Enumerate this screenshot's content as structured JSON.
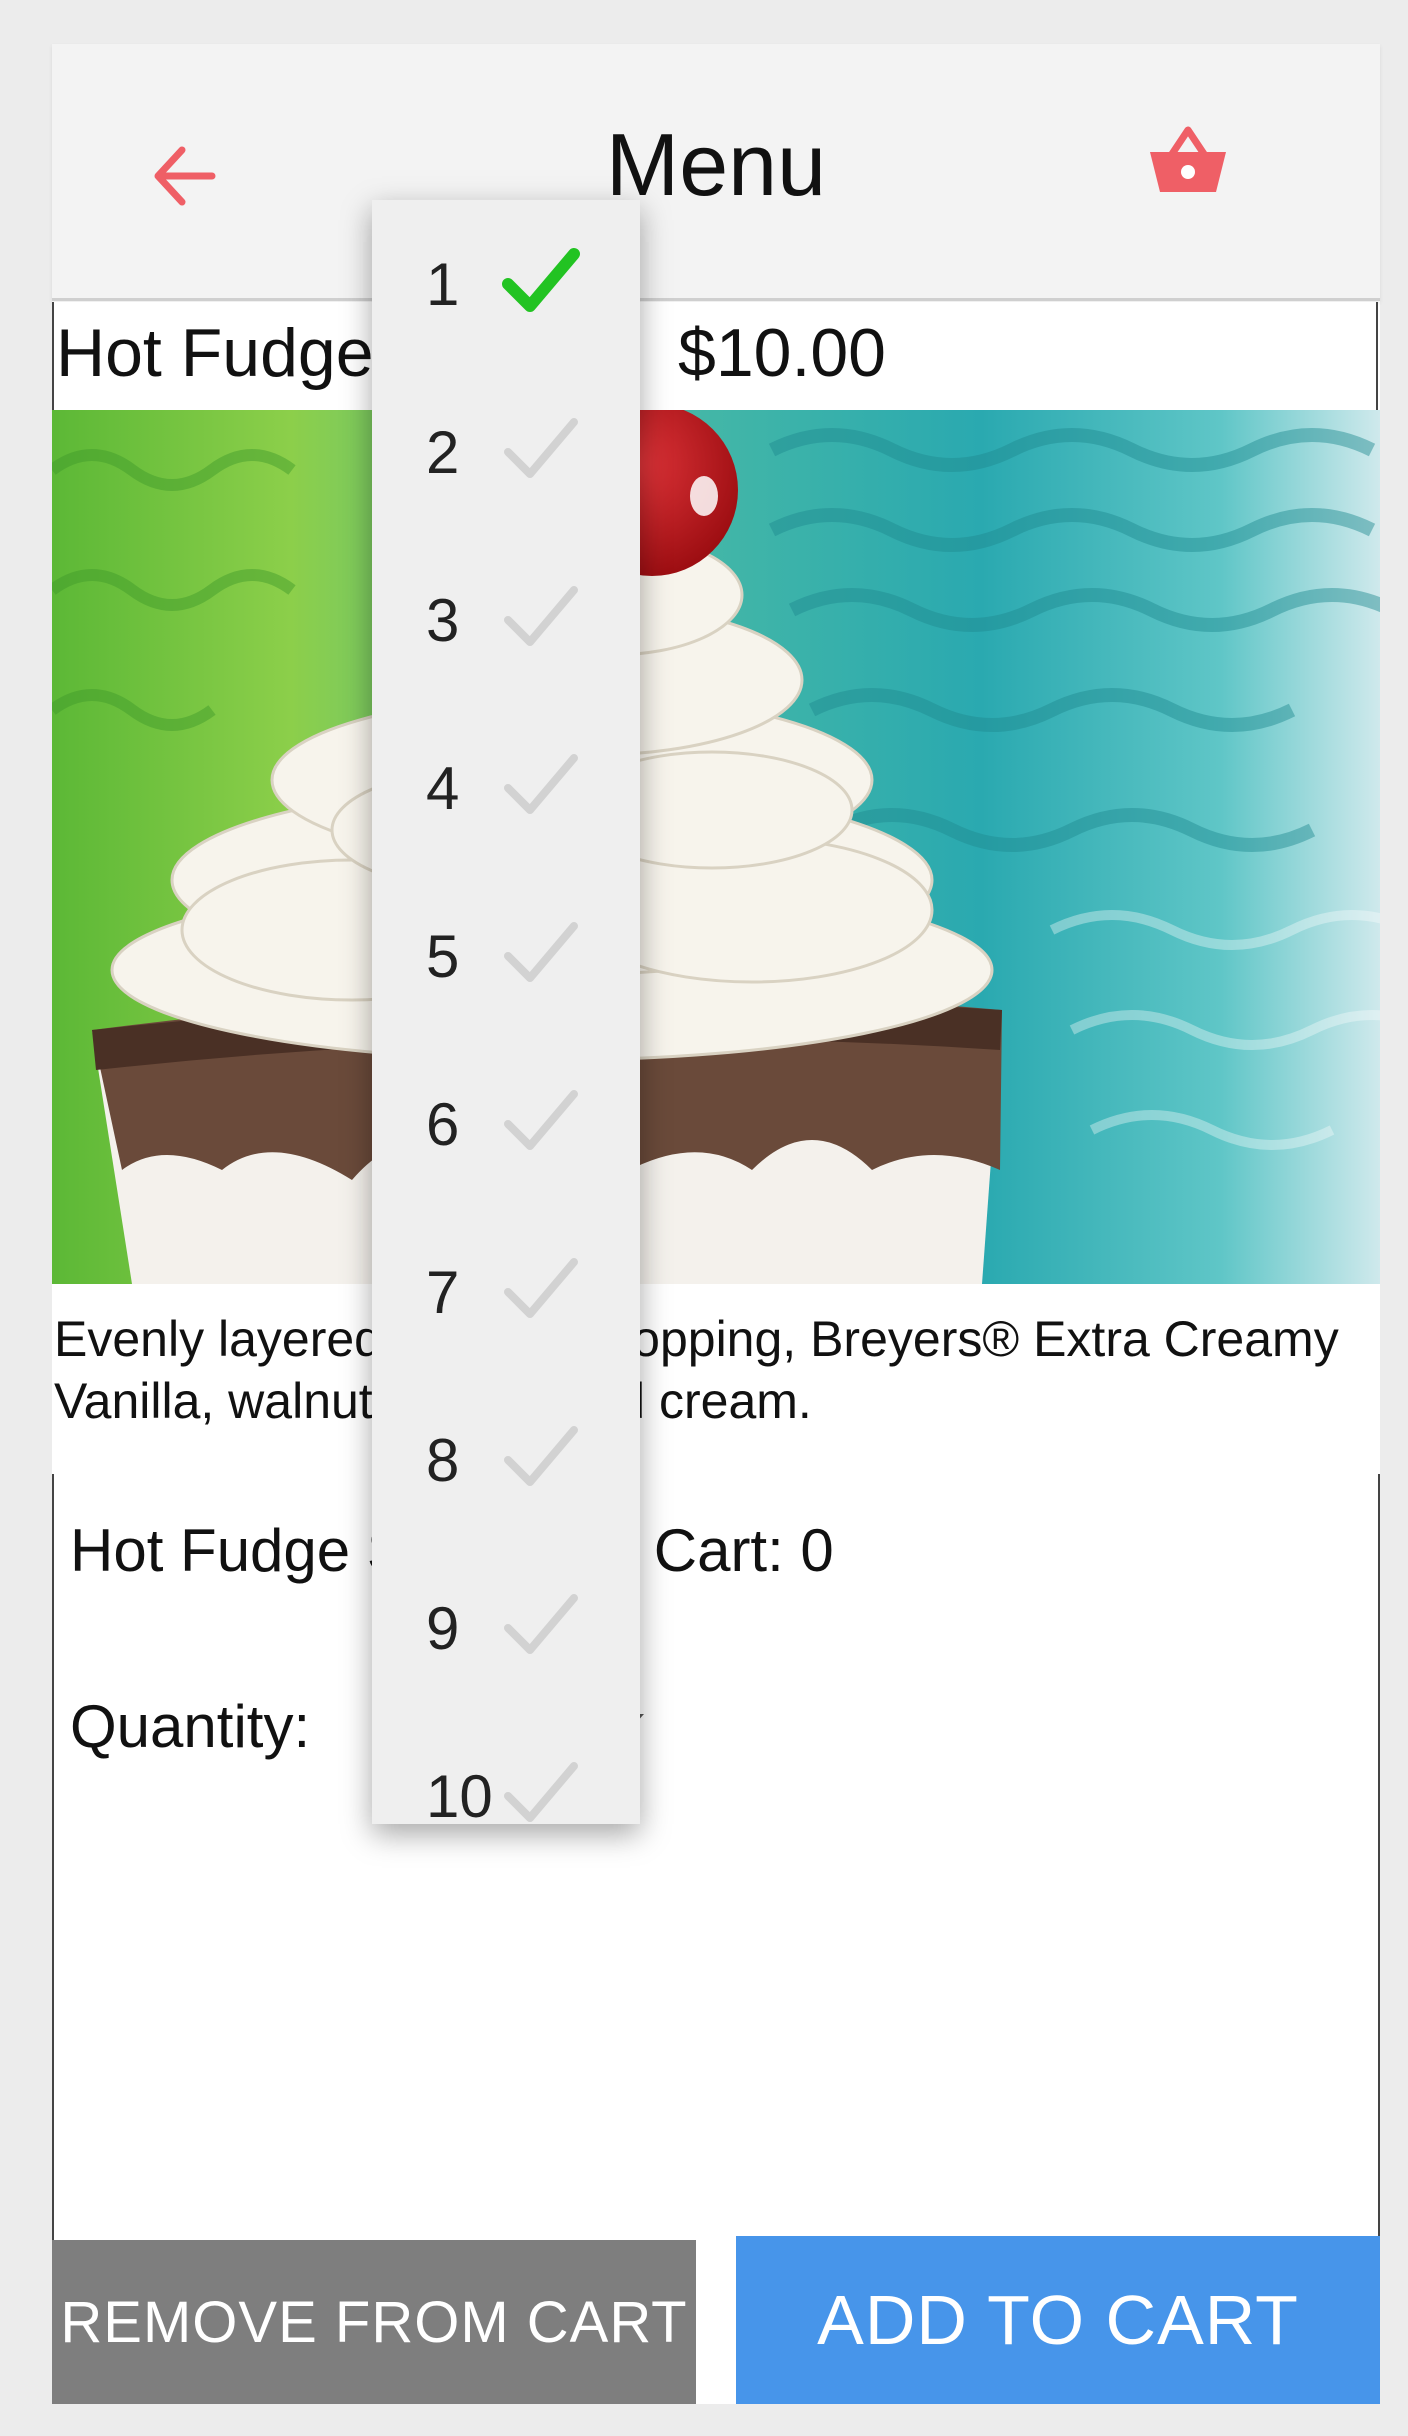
{
  "header": {
    "title": "Menu",
    "back_icon": "arrow-left-icon",
    "cart_icon": "shopping-basket-icon",
    "accent_color": "#ef5f66"
  },
  "item": {
    "name": "Hot Fudge Sundae",
    "price": "$10.00",
    "image_subject": "hot fudge sundae with whipped cream and cherry",
    "description": "Evenly layered hot fudge topping, Breyers® Extra Creamy Vanilla, walnuts & whipped cream."
  },
  "cart": {
    "in_cart_text": "Hot Fudge Sundae in Cart: 0",
    "quantity_label": "Quantity:",
    "quantity_selected": "1"
  },
  "buttons": {
    "remove": "REMOVE FROM CART",
    "add": "ADD TO CART",
    "remove_color": "#7e7e7e",
    "add_color": "#4795ea"
  },
  "dropdown": {
    "options": [
      "1",
      "2",
      "3",
      "4",
      "5",
      "6",
      "7",
      "8",
      "9",
      "10"
    ],
    "selected": "1",
    "selected_check_color": "#22c322",
    "unselected_check_color": "#d2d2d2"
  }
}
